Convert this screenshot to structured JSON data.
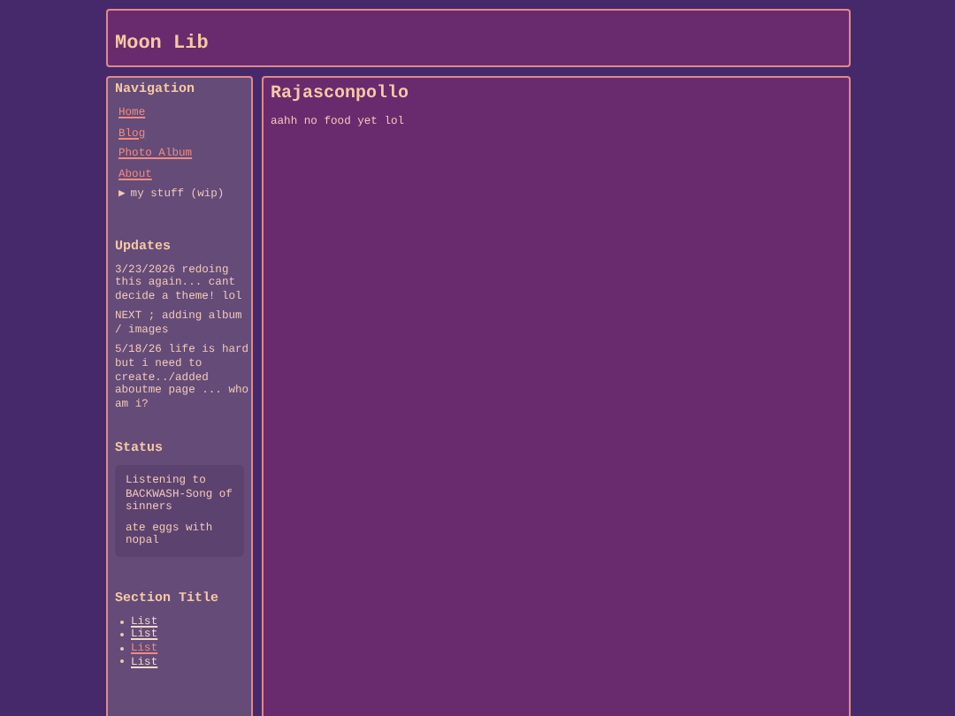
{
  "header": {
    "title": "Moon Lib"
  },
  "sidebar": {
    "navigation": {
      "title": "Navigation",
      "links": [
        "Home",
        "Blog",
        "Photo Album",
        "About"
      ],
      "folder": {
        "marker": "▶",
        "label": "my stuff (wip)",
        "expanded": false
      }
    },
    "updates": {
      "title": "Updates",
      "entries": [
        "3/23/2026 redoing this again... cant decide a theme! lol",
        "NEXT ; adding album / images",
        "5/18/26 life is hard but i need to create../added aboutme page ... who am i?"
      ]
    },
    "status": {
      "title": "Status",
      "entries": [
        "Listening to BACKWASH-Song of sinners",
        "ate eggs with nopal"
      ]
    },
    "section": {
      "title": "Section Title",
      "items": [
        {
          "label": "List",
          "selected": false
        },
        {
          "label": "List",
          "selected": false
        },
        {
          "label": "List",
          "selected": true
        },
        {
          "label": "List",
          "selected": false
        }
      ]
    }
  },
  "main": {
    "title": "Rajasconpollo",
    "text": "aahh no food yet lol"
  }
}
